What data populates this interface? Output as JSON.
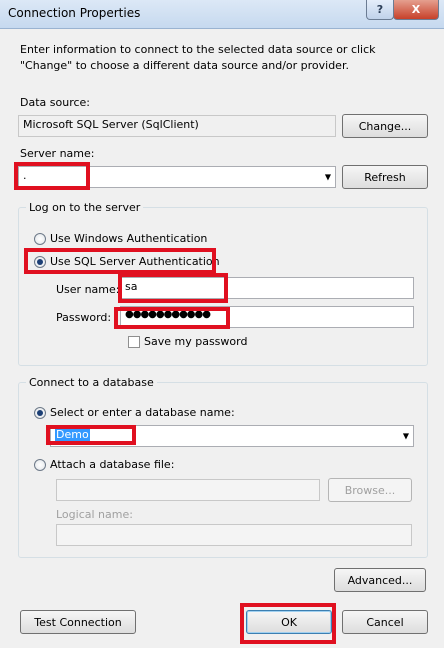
{
  "window": {
    "title": "Connection Properties",
    "help_label": "?",
    "close_label": "X"
  },
  "intro": "Enter information to connect to the selected data source or click \"Change\" to choose a different data source and/or provider.",
  "data_source": {
    "label": "Data source:",
    "value": "Microsoft SQL Server (SqlClient)",
    "change_label": "Change..."
  },
  "server": {
    "label": "Server name:",
    "value": ".",
    "refresh_label": "Refresh"
  },
  "logon": {
    "group_label": "Log on to the server",
    "windows_auth_label": "Use Windows Authentication",
    "sql_auth_label": "Use SQL Server Authentication",
    "username_label": "User name:",
    "username_value": "sa",
    "password_label": "Password:",
    "password_value": "●●●●●●●●●●●",
    "save_password_label": "Save my password"
  },
  "database": {
    "group_label": "Connect to a database",
    "select_label": "Select or enter a database name:",
    "selected_value": "Demo",
    "attach_label": "Attach a database file:",
    "browse_label": "Browse...",
    "logical_name_label": "Logical name:"
  },
  "buttons": {
    "advanced": "Advanced...",
    "test_connection": "Test Connection",
    "ok": "OK",
    "cancel": "Cancel"
  }
}
